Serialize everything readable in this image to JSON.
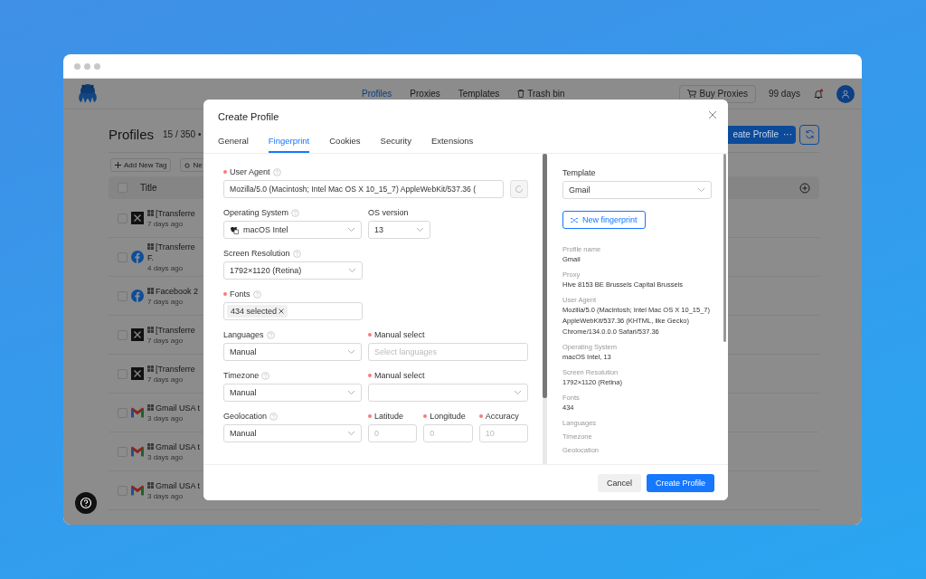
{
  "app": {
    "nav": [
      {
        "label": "Profiles",
        "selected": true
      },
      {
        "label": "Proxies",
        "selected": false
      },
      {
        "label": "Templates",
        "selected": false
      }
    ],
    "trash": "Trash bin",
    "buy_button": "Buy Proxies",
    "days_left": "99 days",
    "has_notification": true
  },
  "page": {
    "title": "Profiles",
    "count": "15 / 350 •",
    "create_button": "eate Profile",
    "more_button": "···",
    "tag_buttons": [
      {
        "kind": "add",
        "label": "Add New Tag"
      },
      {
        "kind": "other",
        "label": "Ne"
      }
    ],
    "table": {
      "columns": [
        "Title"
      ],
      "all_checked": false,
      "rows": [
        {
          "kind": "x",
          "checked": false,
          "title": "[Transferre",
          "time": "7 days ago"
        },
        {
          "kind": "facebook",
          "checked": false,
          "title": "[Transferre",
          "title_2": "F.",
          "time": "4 days ago"
        },
        {
          "kind": "facebook",
          "checked": false,
          "title": "Facebook 2",
          "time": "7 days ago"
        },
        {
          "kind": "x",
          "checked": false,
          "title": "[Transferre",
          "time": "7 days ago"
        },
        {
          "kind": "x",
          "checked": false,
          "title": "[Transferre",
          "time": "7 days ago"
        },
        {
          "kind": "gmail",
          "checked": false,
          "title": "Gmail USA t",
          "time": "3 days ago"
        },
        {
          "kind": "gmail",
          "checked": false,
          "title": "Gmail USA t",
          "time": "3 days ago"
        },
        {
          "kind": "gmail",
          "checked": false,
          "title": "Gmail USA t",
          "time": "3 days ago"
        }
      ]
    }
  },
  "modal": {
    "title": "Create Profile",
    "tabs": [
      {
        "label": "General",
        "selected": false
      },
      {
        "label": "Fingerprint",
        "selected": true
      },
      {
        "label": "Cookies",
        "selected": false
      },
      {
        "label": "Security",
        "selected": false
      },
      {
        "label": "Extensions",
        "selected": false
      }
    ],
    "user_agent": {
      "label": "User Agent",
      "required": true,
      "help": true,
      "value": "Mozilla/5.0 (Macintosh; Intel Mac OS X 10_15_7) AppleWebKit/537.36 ("
    },
    "operating_system": {
      "label": "Operating System",
      "help": true,
      "value": "macOS Intel"
    },
    "os_version": {
      "label": "OS version",
      "value": "13"
    },
    "screen_resolution": {
      "label": "Screen Resolution",
      "help": true,
      "value": "1792×1120 (Retina)"
    },
    "fonts": {
      "label": "Fonts",
      "required": true,
      "help": true,
      "tag": "434 selected"
    },
    "languages": {
      "label": "Languages",
      "help": true,
      "value": "Manual",
      "manual": {
        "label": "Manual select",
        "required": true,
        "placeholder": "Select languages"
      }
    },
    "timezone": {
      "label": "Timezone",
      "help": true,
      "value": "Manual",
      "manual": {
        "label": "Manual select",
        "required": true
      }
    },
    "geolocation": {
      "label": "Geolocation",
      "help": true,
      "value": "Manual",
      "fields": [
        {
          "label": "Latitude",
          "required": true,
          "placeholder": "0"
        },
        {
          "label": "Longitude",
          "required": true,
          "placeholder": "0"
        },
        {
          "label": "Accuracy",
          "required": true,
          "placeholder": "10"
        }
      ]
    },
    "template": {
      "label": "Template",
      "value": "Gmail"
    },
    "new_fingerprint": "New fingerprint",
    "summary": [
      {
        "label": "Profile name",
        "value": "Gmail"
      },
      {
        "label": "Proxy",
        "value": "Hive 8153 BE Brussels Capital Brussels"
      },
      {
        "label": "User Agent",
        "value": "Mozilla/5.0 (Macintosh; Intel Mac OS X 10_15_7) AppleWebKit/537.36 (KHTML, like Gecko) Chrome/134.0.0.0 Safari/537.36"
      },
      {
        "label": "Operating System",
        "value": "macOS Intel, 13"
      },
      {
        "label": "Screen Resolution",
        "value": "1792×1120 (Retina)"
      },
      {
        "label": "Fonts",
        "value": "434"
      },
      {
        "label": "Languages"
      },
      {
        "label": "Timezone"
      },
      {
        "label": "Geolocation"
      }
    ],
    "cancel": "Cancel",
    "submit": "Create Profile"
  }
}
